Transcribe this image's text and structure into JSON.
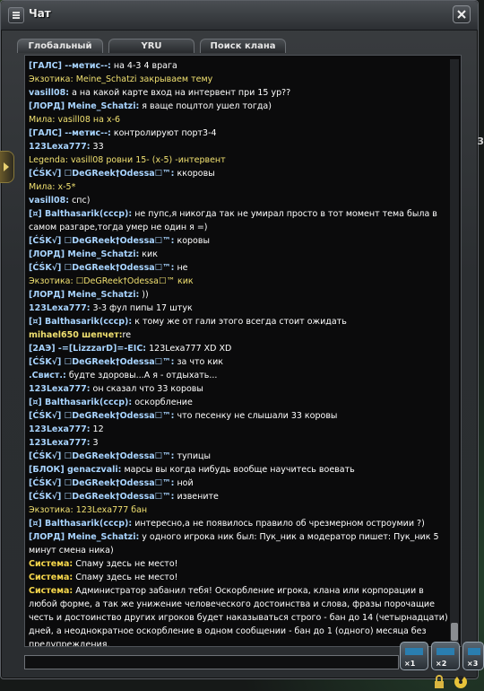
{
  "window": {
    "title": "Чат",
    "title_icon": "chat-icon",
    "close_icon": "close-icon"
  },
  "tabs": [
    {
      "label": "Глобальный"
    },
    {
      "label": "YRU"
    },
    {
      "label": "Поиск клана"
    }
  ],
  "side_label": "3",
  "hud_slots": [
    {
      "label": "×1"
    },
    {
      "label": "×2"
    },
    {
      "label": "×3"
    }
  ],
  "colors": {
    "player_name": "#a8d4ff",
    "system_event": "#f0e070",
    "system_label": "#f7d84c",
    "background": "#0b0b0c"
  },
  "messages": [
    {
      "name": "[ГАЛС] --метис--:",
      "text": " на 4-3 4 врага",
      "style": "player"
    },
    {
      "name": "",
      "text": "Экзотика:  Meine_Schatzi закрываем тему",
      "style": "event"
    },
    {
      "name": "vasill08:",
      "text": " а на какой карте вход на интервент при 15 ур??",
      "style": "player"
    },
    {
      "name": "[ЛОРД] Meine_Schatzi:",
      "text": " я ваще поцлтол ушел тогда)",
      "style": "player"
    },
    {
      "name": "",
      "text": "Мила:  vasill08 на х-6",
      "style": "event"
    },
    {
      "name": "[ГАЛС] --метис--:",
      "text": " контролируют порт3-4",
      "style": "player"
    },
    {
      "name": "123Lexa777:",
      "text": " 33",
      "style": "player"
    },
    {
      "name": "",
      "text": "Legenda:  vasill08 ровни 15- (х-5) -интервент",
      "style": "event"
    },
    {
      "name": "[ĆŚK√] ☐DeGReek†Odessa☐™:",
      "text": " ккоровы",
      "style": "player"
    },
    {
      "name": "",
      "text": "Мила:  х-5*",
      "style": "event"
    },
    {
      "name": "vasill08:",
      "text": " спс)",
      "style": "player"
    },
    {
      "name": "[¤] Balthasarik(сccp):",
      "text": " не пупс,я никогда так не умирал просто в тот момент тема была в самом разгаре,тогда умер не один я =)",
      "style": "player"
    },
    {
      "name": "[ĆŚK√] ☐DeGReek†Odessa☐™:",
      "text": " коровы",
      "style": "player"
    },
    {
      "name": "[ЛОРД] Meine_Schatzi:",
      "text": " кик",
      "style": "player"
    },
    {
      "name": "[ĆŚK√] ☐DeGReek†Odessa☐™:",
      "text": " не",
      "style": "player"
    },
    {
      "name": "",
      "text": "Экзотика:  ☐DeGReek†Odessa☐™ кик",
      "style": "event"
    },
    {
      "name": "[ЛОРД] Meine_Schatzi:",
      "text": " ))",
      "style": "player"
    },
    {
      "name": "123Lexa777:",
      "text": " 3-3 фул пипы 17 штук",
      "style": "player"
    },
    {
      "name": "[¤] Balthasarik(сccp):",
      "text": " к тому же от гали этого всегда стоит ожидать",
      "style": "player"
    },
    {
      "name": "mihael650 шепчет:",
      "text": "re",
      "style": "whisper"
    },
    {
      "name": "[2АЭ] -=[LizzzarD]=-EIC:",
      "text": " 123Lexa777 XD XD",
      "style": "player"
    },
    {
      "name": "[ĆŚK√] ☐DeGReek†Odessa☐™:",
      "text": " за что кик",
      "style": "player"
    },
    {
      "name": ".Свист.:",
      "text": " будте здоровы...А я - отдыхать...",
      "style": "player"
    },
    {
      "name": "123Lexa777:",
      "text": " он сказал что 33 коровы",
      "style": "player"
    },
    {
      "name": "[¤] Balthasarik(сccp):",
      "text": " оскорбление",
      "style": "player"
    },
    {
      "name": "[ĆŚK√] ☐DeGReek†Odessa☐™:",
      "text": " что песенку не слышали 33 коровы",
      "style": "player"
    },
    {
      "name": "123Lexa777:",
      "text": " 12",
      "style": "player"
    },
    {
      "name": "123Lexa777:",
      "text": " 3",
      "style": "player"
    },
    {
      "name": "[ĆŚK√] ☐DeGReek†Odessa☐™:",
      "text": " тупицы",
      "style": "player"
    },
    {
      "name": "[БЛОК] genaczvali:",
      "text": " марсы вы когда нибудь вообще научитесь воевать",
      "style": "player"
    },
    {
      "name": "[ĆŚK√] ☐DeGReek†Odessa☐™:",
      "text": " ной",
      "style": "player"
    },
    {
      "name": "[ĆŚK√] ☐DeGReek†Odessa☐™:",
      "text": " извените",
      "style": "player"
    },
    {
      "name": "",
      "text": "Экзотика:  123Lexa777 бан",
      "style": "event"
    },
    {
      "name": "[¤] Balthasarik(сccp):",
      "text": " интересно,а не появилось правило об чрезмерном остроумии ?)",
      "style": "player"
    },
    {
      "name": "[ЛОРД] Meine_Schatzi:",
      "text": " у одного игрока ник был: Пук_ник  а модератор пишет: Пук_ник 5 минут смена ника)",
      "style": "player"
    },
    {
      "name": "Система:",
      "text": " Спаму здесь не место!",
      "style": "system"
    },
    {
      "name": "Система:",
      "text": " Спаму здесь не место!",
      "style": "system"
    },
    {
      "name": "Система:",
      "text": " Администратор забанил тебя! Оскорбление игрока, клана или корпорации в любой форме, а так же унижение человеческого достоинства и слова, фразы порочащие честь и достоинство других игроков будет наказываться строго - бан до 14 (четырнадцати) дней, а неоднократное оскорбление в одном сообщении - бан до 1 (одного) месяца без предупреждения.",
      "style": "system"
    }
  ]
}
